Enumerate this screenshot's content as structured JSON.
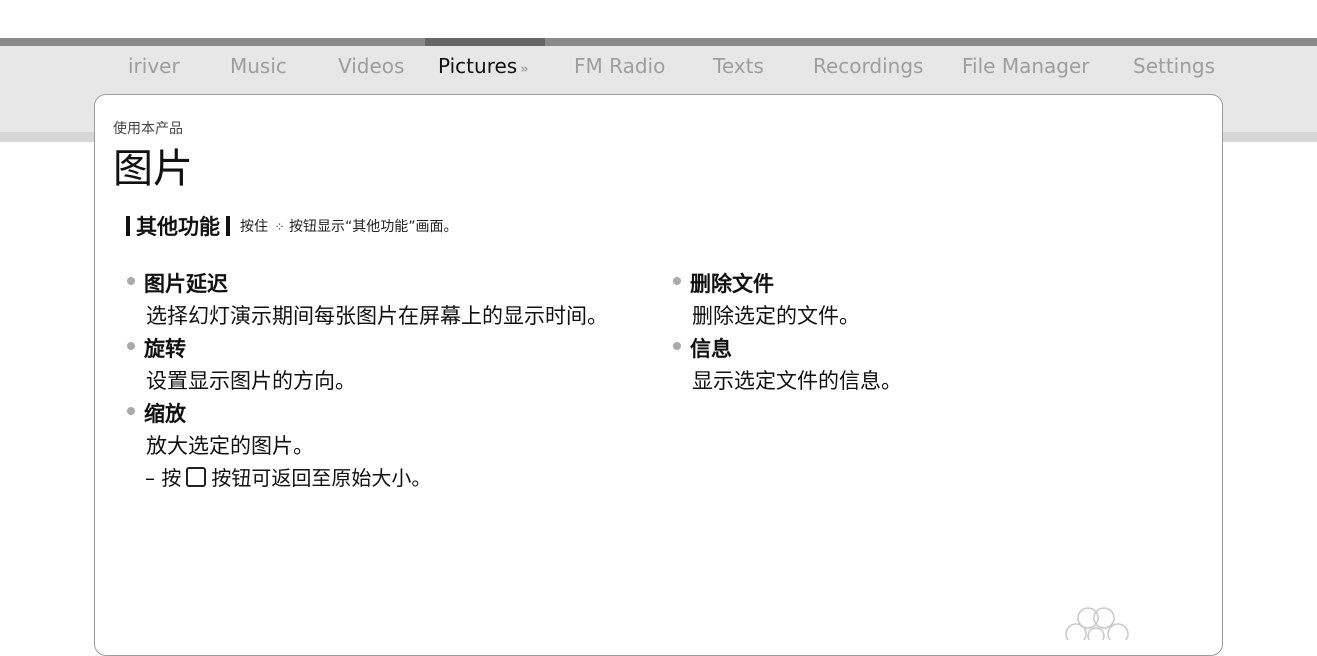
{
  "nav": {
    "tabs": [
      {
        "label": "iriver",
        "active": false
      },
      {
        "label": "Music",
        "active": false
      },
      {
        "label": "Videos",
        "active": false
      },
      {
        "label": "Pictures",
        "active": true
      },
      {
        "label": "FM Radio",
        "active": false
      },
      {
        "label": "Texts",
        "active": false
      },
      {
        "label": "Recordings",
        "active": false
      },
      {
        "label": "File Manager",
        "active": false
      },
      {
        "label": "Settings",
        "active": false
      }
    ],
    "active_arrow_icon": "double-chevron-right-icon"
  },
  "page": {
    "breadcrumb": "使用本产品",
    "title": "图片"
  },
  "section": {
    "title": "其他功能",
    "note_prefix": "按住",
    "note_icon": "dots-menu-icon",
    "note_suffix": "按钮显示“其他功能”画面。"
  },
  "features_left": [
    {
      "name": "图片延迟",
      "desc": "选择幻灯演示期间每张图片在屏幕上的显示时间。"
    },
    {
      "name": "旋转",
      "desc": "设置显示图片的方向。"
    },
    {
      "name": "缩放",
      "desc": "放大选定的图片。"
    }
  ],
  "zoom_note": {
    "prefix": "– 按",
    "icon": "square-button-icon",
    "suffix": "按钮可返回至原始大小。"
  },
  "features_right": [
    {
      "name": "删除文件",
      "desc": "删除选定的文件。"
    },
    {
      "name": "信息",
      "desc": "显示选定文件的信息。"
    }
  ],
  "colors": {
    "nav_bg": "#e7e7e7",
    "tab_inactive": "#9e9e9e",
    "tab_active": "#111111",
    "bullet": "#aaaaaa"
  }
}
